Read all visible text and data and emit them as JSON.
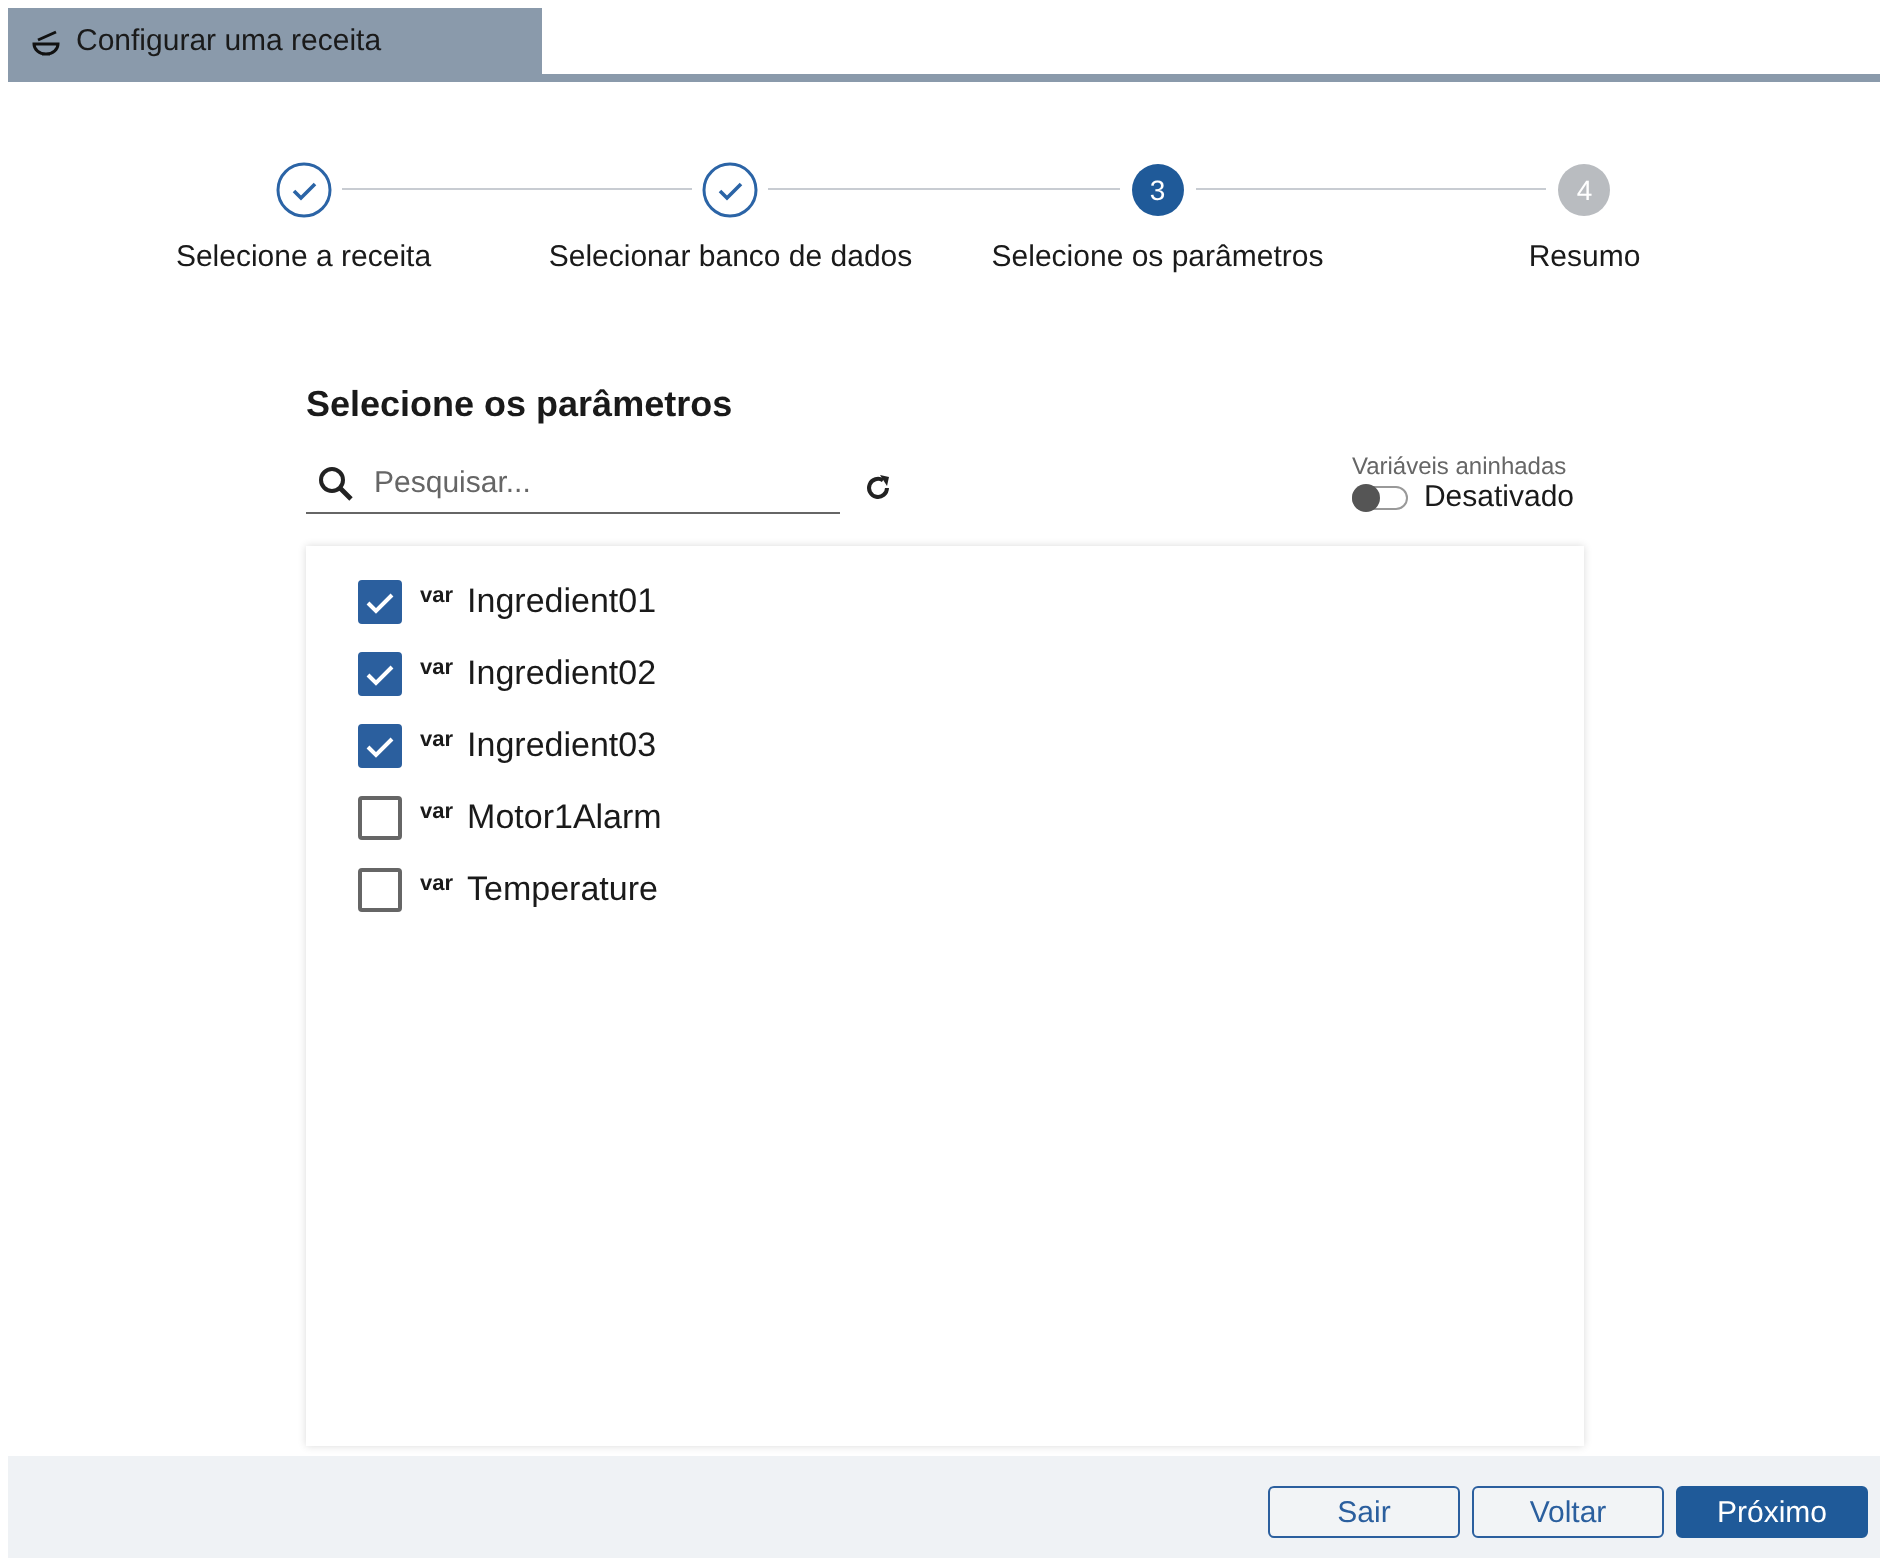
{
  "window": {
    "title": "Configurar uma receita"
  },
  "steps": [
    {
      "label": "Selecione a receita",
      "completed": true,
      "selected": false
    },
    {
      "label": "Selecionar banco de dados",
      "completed": true,
      "selected": false
    },
    {
      "number": "3",
      "label": "Selecione os parâmetros",
      "completed": false,
      "selected": true
    },
    {
      "number": "4",
      "label": "Resumo",
      "completed": false,
      "selected": false
    }
  ],
  "section_title": "Selecione os parâmetros",
  "search": {
    "placeholder": "Pesquisar..."
  },
  "nested_toggle": {
    "label": "Variáveis aninhadas",
    "on": false,
    "state_text": "Desativado"
  },
  "parameters": [
    {
      "type": "var",
      "name": "Ingredient01",
      "checked": true
    },
    {
      "type": "var",
      "name": "Ingredient02",
      "checked": true
    },
    {
      "type": "var",
      "name": "Ingredient03",
      "checked": true
    },
    {
      "type": "var",
      "name": "Motor1Alarm",
      "checked": false
    },
    {
      "type": "var",
      "name": "Temperature",
      "checked": false
    }
  ],
  "buttons": [
    {
      "label": "Sair",
      "kind": "secondary"
    },
    {
      "label": "Voltar",
      "kind": "secondary"
    },
    {
      "label": "Próximo",
      "kind": "primary"
    }
  ]
}
